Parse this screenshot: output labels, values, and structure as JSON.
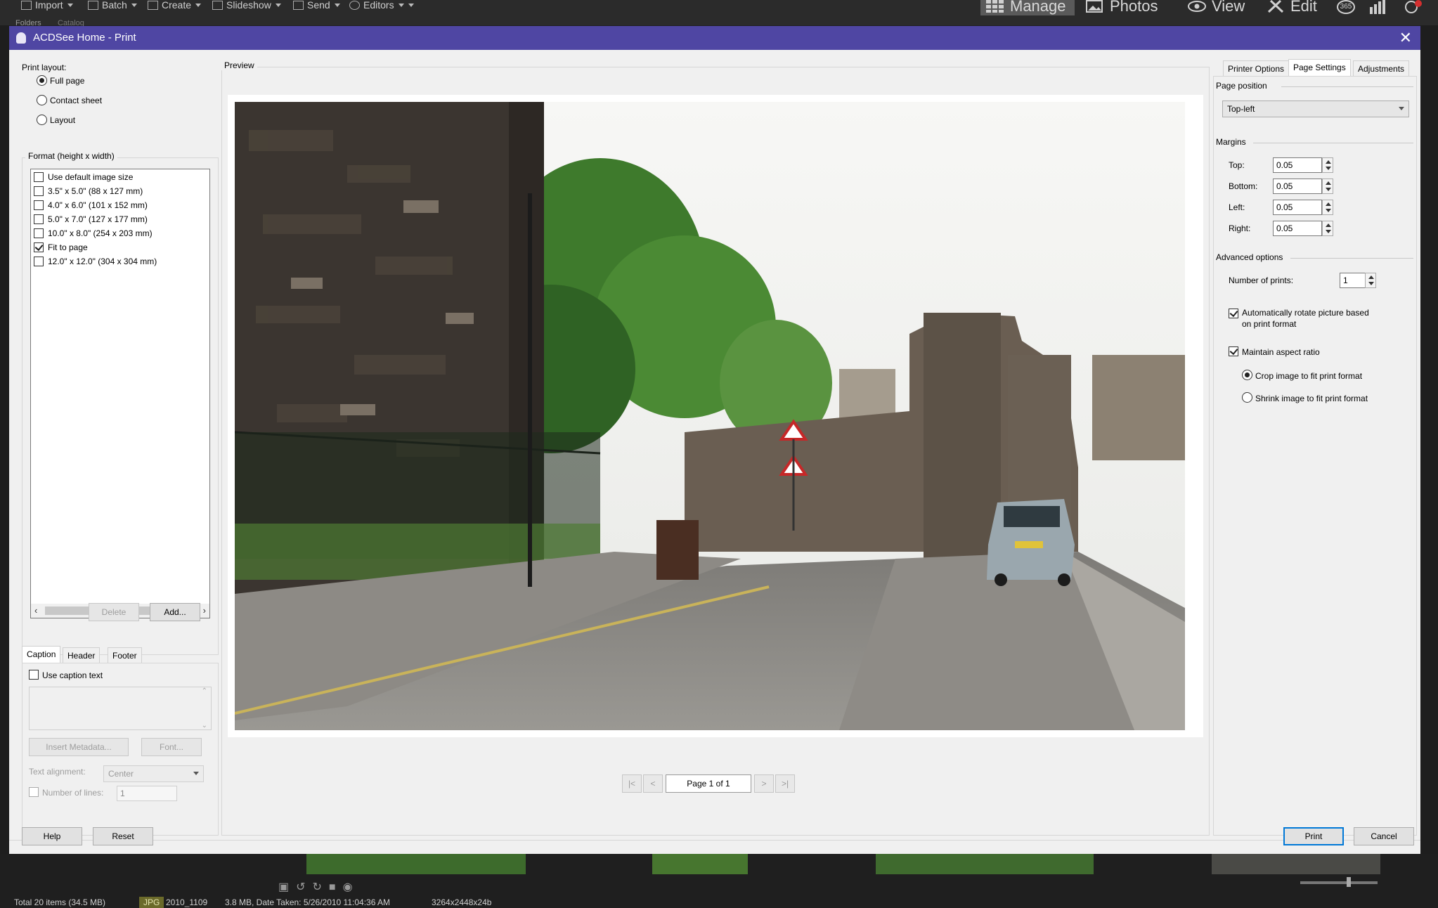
{
  "toolbar": {
    "import": "Import",
    "batch": "Batch",
    "create": "Create",
    "slideshow": "Slideshow",
    "send": "Send",
    "editors": "Editors",
    "folders_tab": "Folders",
    "catalog_tab": "Catalog"
  },
  "modes": {
    "manage": "Manage",
    "photos": "Photos",
    "view": "View",
    "edit": "Edit",
    "badge_365": "365"
  },
  "dialog": {
    "title": "ACDSee Home - Print",
    "print_layout_label": "Print layout:",
    "layouts": [
      {
        "label": "Full page",
        "selected": true
      },
      {
        "label": "Contact sheet",
        "selected": false
      },
      {
        "label": "Layout",
        "selected": false
      }
    ],
    "format_label": "Format (height x width)",
    "formats": [
      {
        "label": "Use default image size",
        "checked": false
      },
      {
        "label": "3.5\" x 5.0\" (88 x 127 mm)",
        "checked": false
      },
      {
        "label": "4.0\" x 6.0\" (101 x 152 mm)",
        "checked": false
      },
      {
        "label": "5.0\" x 7.0\" (127 x 177 mm)",
        "checked": false
      },
      {
        "label": "10.0\" x 8.0\" (254 x 203 mm)",
        "checked": false
      },
      {
        "label": "Fit to page",
        "checked": true
      },
      {
        "label": "12.0\" x 12.0\" (304 x 304 mm)",
        "checked": false
      }
    ],
    "delete_label": "Delete",
    "add_label": "Add...",
    "caption_tabs": [
      "Caption",
      "Header",
      "Footer"
    ],
    "use_caption_label": "Use caption text",
    "insert_metadata_label": "Insert Metadata...",
    "font_label": "Font...",
    "text_alignment_label": "Text alignment:",
    "text_alignment_value": "Center",
    "number_of_lines_label": "Number of lines:",
    "number_of_lines_value": "1",
    "preview_label": "Preview",
    "page_indicator": "Page 1 of 1",
    "nav": {
      "first": "|<",
      "prev": "<",
      "next": ">",
      "last": ">|"
    },
    "right_tabs": [
      "Printer Options",
      "Page Settings",
      "Adjustments"
    ],
    "page_position_label": "Page position",
    "page_position_value": "Top-left",
    "margins_label": "Margins",
    "margins": [
      {
        "label": "Top:",
        "value": "0.05"
      },
      {
        "label": "Bottom:",
        "value": "0.05"
      },
      {
        "label": "Left:",
        "value": "0.05"
      },
      {
        "label": "Right:",
        "value": "0.05"
      }
    ],
    "advanced_label": "Advanced options",
    "number_of_prints_label": "Number of prints:",
    "number_of_prints_value": "1",
    "auto_rotate_line1": "Automatically rotate picture based",
    "auto_rotate_line2": "on print format",
    "maintain_aspect_label": "Maintain aspect ratio",
    "crop_label": "Crop image to fit print format",
    "shrink_label": "Shrink image to fit print format",
    "help_label": "Help",
    "reset_label": "Reset",
    "print_label": "Print",
    "cancel_label": "Cancel"
  },
  "status": {
    "total": "Total 20 items  (34.5 MB)",
    "type": "JPG",
    "name": "2010_1109",
    "size_date": "3.8 MB, Date Taken: 5/26/2010 11:04:36 AM",
    "dims": "3264x2448x24b"
  },
  "colors": {
    "titlebar": "#4f46a3",
    "primary_border": "#0078d7"
  }
}
